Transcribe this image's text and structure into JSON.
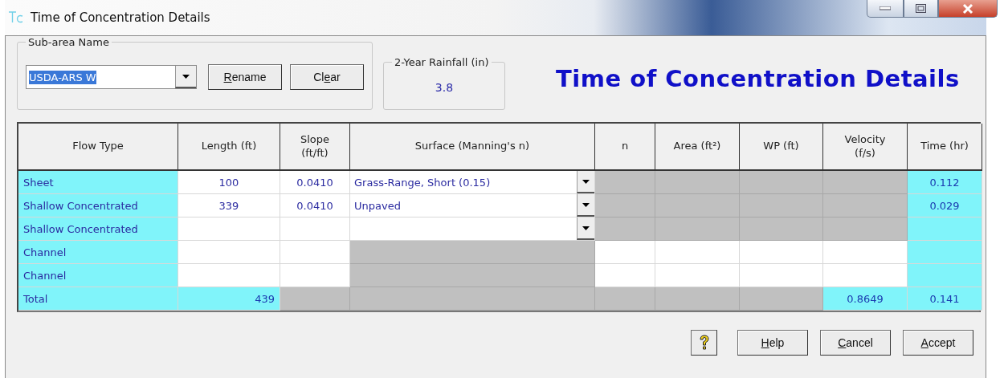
{
  "window": {
    "title": "Time of Concentration Details"
  },
  "sub_area": {
    "label": "Sub-area Name",
    "value": "USDA-ARS W",
    "selected": true,
    "buttons": [
      {
        "label": [
          {
            "text": "R",
            "underlined": true
          },
          {
            "text": "ename",
            "underlined": false
          }
        ]
      },
      {
        "label": [
          {
            "text": "Cl",
            "underlined": false
          },
          {
            "text": "e",
            "underlined": true
          },
          {
            "text": "ar",
            "underlined": false
          }
        ]
      }
    ]
  },
  "rainfall": {
    "label": "2-Year Rainfall (in)",
    "value": "3.8"
  },
  "heading": "Time of Concentration Details",
  "table": {
    "columns": [
      {
        "lines": [
          "Flow Type"
        ]
      },
      {
        "lines": [
          "Length (ft)"
        ]
      },
      {
        "lines": [
          "Slope",
          "(ft/ft)"
        ]
      },
      {
        "lines": [
          "Surface (Manning's n)"
        ]
      },
      {
        "lines": [
          "n"
        ]
      },
      {
        "lines": [
          "Area (ft²)"
        ]
      },
      {
        "lines": [
          "WP (ft)"
        ]
      },
      {
        "lines": [
          "Velocity",
          "(f/s)"
        ]
      },
      {
        "lines": [
          "Time (hr)"
        ]
      }
    ],
    "rows": [
      {
        "cells": [
          {
            "kind": "flow",
            "text": "Sheet"
          },
          {
            "kind": "input",
            "text": "100"
          },
          {
            "kind": "input",
            "text": "0.0410"
          },
          {
            "kind": "select",
            "text": "Grass-Range, Short (0.15)"
          },
          {
            "kind": "disabled"
          },
          {
            "kind": "disabled"
          },
          {
            "kind": "disabled"
          },
          {
            "kind": "disabled"
          },
          {
            "kind": "computed",
            "text": "0.112"
          }
        ]
      },
      {
        "cells": [
          {
            "kind": "flow",
            "text": "Shallow Concentrated"
          },
          {
            "kind": "input",
            "text": "339"
          },
          {
            "kind": "input",
            "text": "0.0410"
          },
          {
            "kind": "select",
            "text": "Unpaved"
          },
          {
            "kind": "disabled"
          },
          {
            "kind": "disabled"
          },
          {
            "kind": "disabled"
          },
          {
            "kind": "disabled"
          },
          {
            "kind": "computed",
            "text": "0.029"
          }
        ]
      },
      {
        "cells": [
          {
            "kind": "flow",
            "text": "Shallow Concentrated"
          },
          {
            "kind": "input"
          },
          {
            "kind": "input"
          },
          {
            "kind": "select"
          },
          {
            "kind": "disabled"
          },
          {
            "kind": "disabled"
          },
          {
            "kind": "disabled"
          },
          {
            "kind": "disabled"
          },
          {
            "kind": "computed"
          }
        ]
      },
      {
        "cells": [
          {
            "kind": "flow",
            "text": "Channel"
          },
          {
            "kind": "input"
          },
          {
            "kind": "input"
          },
          {
            "kind": "disabled"
          },
          {
            "kind": "input"
          },
          {
            "kind": "input"
          },
          {
            "kind": "input"
          },
          {
            "kind": "input"
          },
          {
            "kind": "computed"
          }
        ]
      },
      {
        "cells": [
          {
            "kind": "flow",
            "text": "Channel"
          },
          {
            "kind": "input"
          },
          {
            "kind": "input"
          },
          {
            "kind": "disabled"
          },
          {
            "kind": "input"
          },
          {
            "kind": "input"
          },
          {
            "kind": "input"
          },
          {
            "kind": "input"
          },
          {
            "kind": "computed"
          }
        ]
      },
      {
        "cells": [
          {
            "kind": "flow",
            "text": "Total"
          },
          {
            "kind": "total",
            "text": "439"
          },
          {
            "kind": "disabled"
          },
          {
            "kind": "disabled"
          },
          {
            "kind": "disabled"
          },
          {
            "kind": "disabled"
          },
          {
            "kind": "disabled"
          },
          {
            "kind": "computed",
            "text": "0.8649"
          },
          {
            "kind": "computed",
            "text": "0.141"
          }
        ]
      }
    ]
  },
  "buttons": [
    {
      "kind": "icon"
    },
    {
      "kind": "text",
      "label": [
        {
          "text": "H",
          "underlined": true
        },
        {
          "text": "elp",
          "underlined": false
        }
      ]
    },
    {
      "kind": "text",
      "label": [
        {
          "text": "C",
          "underlined": true
        },
        {
          "text": "ancel",
          "underlined": false
        }
      ]
    },
    {
      "kind": "text",
      "label": [
        {
          "text": "A",
          "underlined": true
        },
        {
          "text": "ccept",
          "underlined": false
        }
      ]
    }
  ]
}
